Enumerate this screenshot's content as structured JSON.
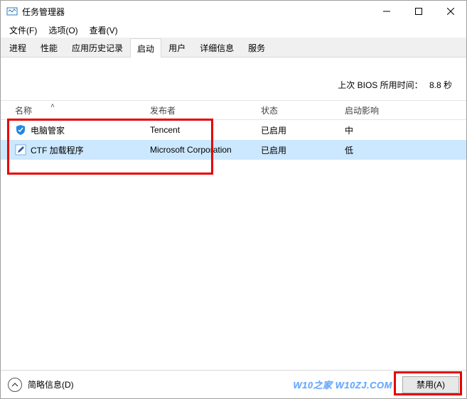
{
  "window": {
    "title": "任务管理器",
    "menu": {
      "file": "文件(F)",
      "options": "选项(O)",
      "view": "查看(V)"
    }
  },
  "tabs": {
    "processes": "进程",
    "performance": "性能",
    "history": "应用历史记录",
    "startup": "启动",
    "users": "用户",
    "details": "详细信息",
    "services": "服务",
    "active": "启动"
  },
  "bios": {
    "label": "上次 BIOS 所用时间：",
    "value": "8.8 秒"
  },
  "columns": {
    "name": "名称",
    "publisher": "发布者",
    "status": "状态",
    "impact": "启动影响"
  },
  "rows": [
    {
      "icon": "shield",
      "name": "电脑管家",
      "publisher": "Tencent",
      "status": "已启用",
      "impact": "中"
    },
    {
      "icon": "pencil",
      "name": "CTF 加载程序",
      "publisher": "Microsoft Corporation",
      "status": "已启用",
      "impact": "低"
    }
  ],
  "footer": {
    "fewer": "简略信息(D)",
    "disable": "禁用(A)",
    "watermark": "W10之家 W10ZJ.COM"
  }
}
